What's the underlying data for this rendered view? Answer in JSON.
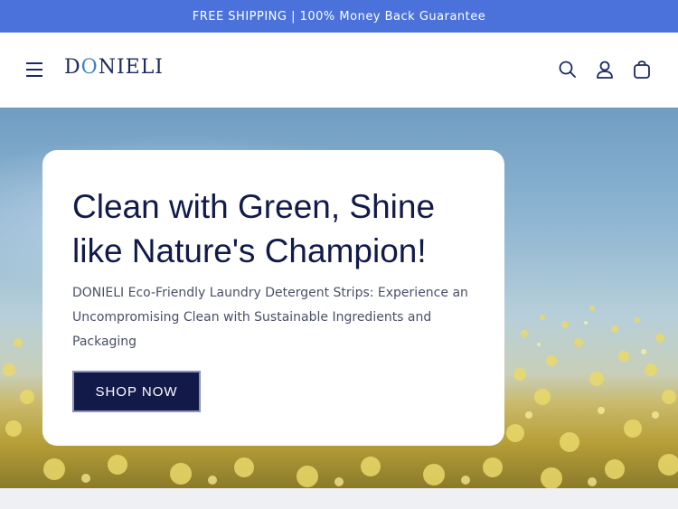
{
  "announcement": {
    "text": "FREE SHIPPING | 100% Money Back Guarantee"
  },
  "header": {
    "logo_parts": [
      "D",
      "O",
      "NIELI"
    ],
    "icons": [
      "menu-icon",
      "search-icon",
      "account-icon",
      "cart-icon"
    ]
  },
  "hero": {
    "headline": "Clean with Green, Shine like Nature's Champion!",
    "description": "DONIELI Eco-Friendly Laundry Detergent Strips: Experience an Uncompromising Clean with Sustainable Ingredients and Packaging",
    "cta_label": "SHOP NOW"
  },
  "colors": {
    "announcement_bg": "#4a72da",
    "primary": "#121a4a",
    "logo_accent": "#3f7fc9"
  }
}
